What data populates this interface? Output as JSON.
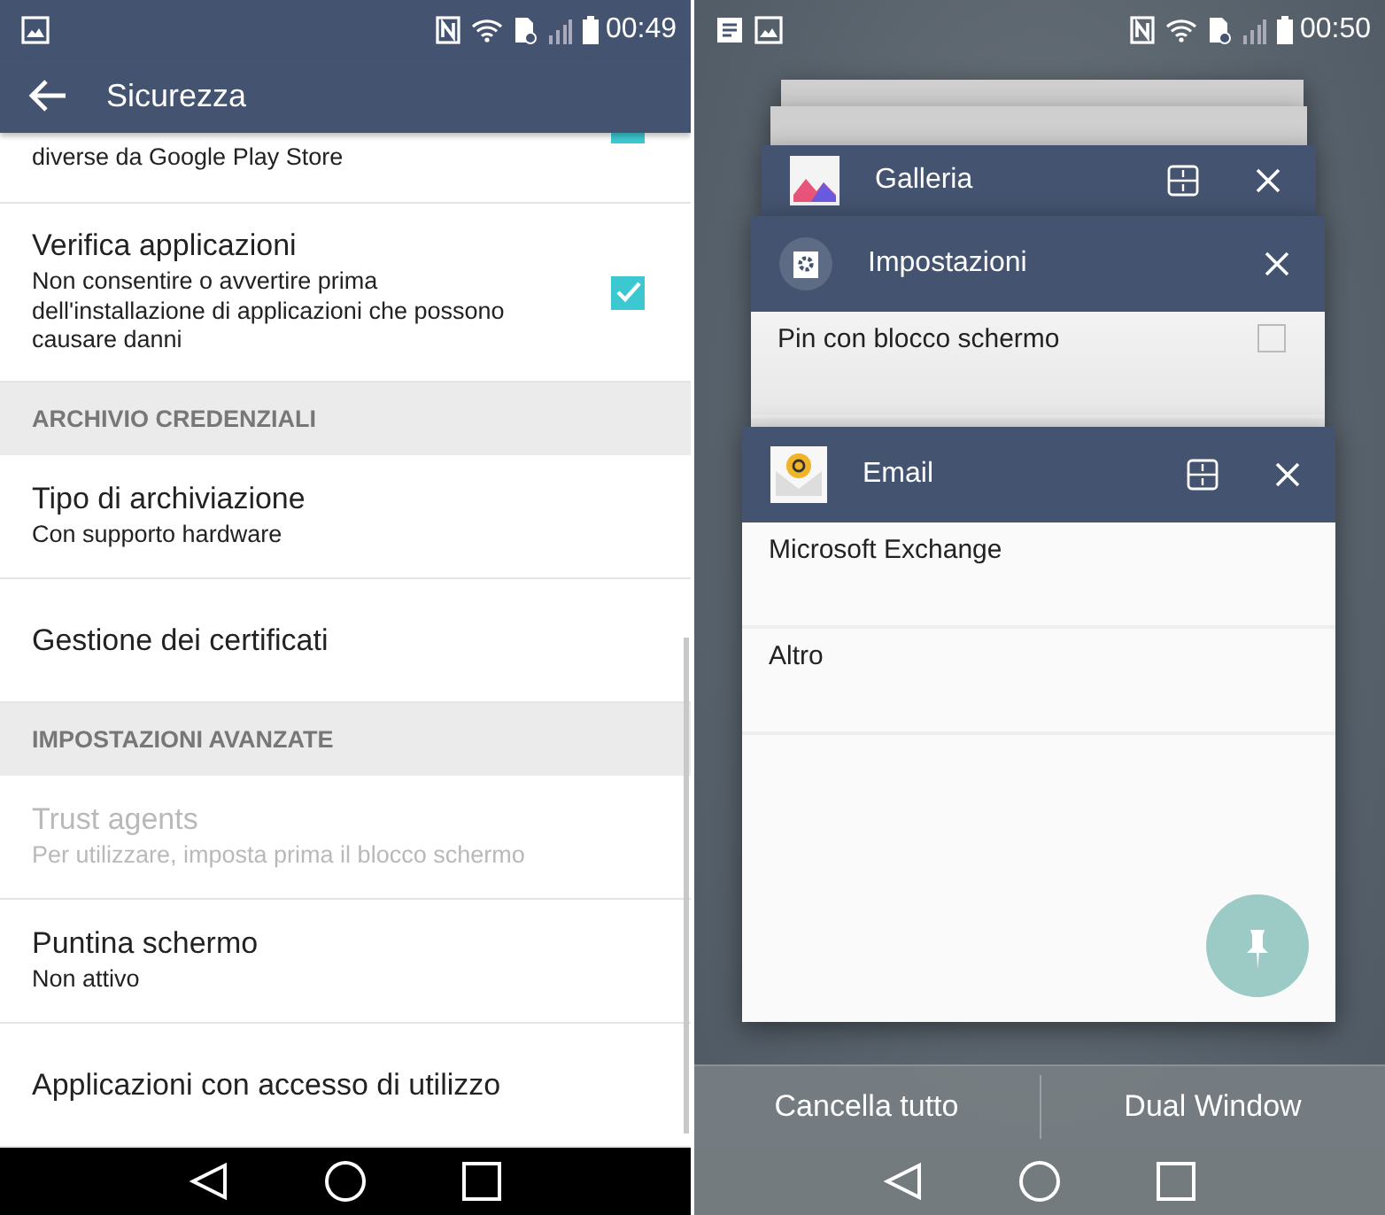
{
  "left": {
    "status_bar": {
      "time": "00:49"
    },
    "title": "Sicurezza",
    "items": [
      {
        "kind": "cut_checkbox",
        "subtitle": "diverse da Google Play Store",
        "checked": true,
        "disabled": false
      },
      {
        "kind": "checkbox",
        "title": "Verifica applicazioni",
        "subtitle": "Non consentire o avvertire prima dell'installazione di applicazioni che possono causare danni",
        "checked": true,
        "disabled": false
      },
      {
        "kind": "header",
        "title": "ARCHIVIO CREDENZIALI"
      },
      {
        "kind": "setting",
        "title": "Tipo di archiviazione",
        "subtitle": "Con supporto hardware",
        "disabled": false
      },
      {
        "kind": "setting",
        "title": "Gestione dei certificati",
        "disabled": false
      },
      {
        "kind": "header",
        "title": "IMPOSTAZIONI AVANZATE"
      },
      {
        "kind": "setting",
        "title": "Trust agents",
        "subtitle": "Per utilizzare, imposta prima il blocco schermo",
        "disabled": true
      },
      {
        "kind": "setting",
        "title": "Puntina schermo",
        "subtitle": "Non attivo",
        "disabled": false
      },
      {
        "kind": "setting",
        "title": "Applicazioni con accesso di utilizzo",
        "disabled": false
      }
    ]
  },
  "right": {
    "status_bar": {
      "time": "00:50"
    },
    "cards": [
      {
        "kind": "stub"
      },
      {
        "kind": "stub"
      },
      {
        "kind": "gallery",
        "title": "Galleria",
        "dual_window": true
      },
      {
        "kind": "settings",
        "title": "Impostazioni",
        "dual_window": false,
        "rows": [
          {
            "label": "Pin con blocco schermo",
            "checked": false
          }
        ]
      },
      {
        "kind": "email",
        "title": "Email",
        "dual_window": true,
        "pinnable": true,
        "rows": [
          {
            "label": "Microsoft Exchange"
          },
          {
            "label": "Altro"
          }
        ]
      }
    ],
    "buttons": [
      "Cancella tutto",
      "Dual Window"
    ]
  }
}
